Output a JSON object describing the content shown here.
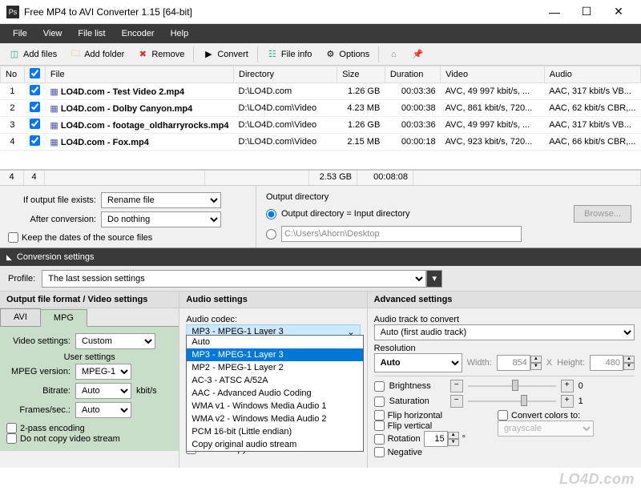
{
  "window": {
    "title": "Free MP4 to AVI Converter 1.15   [64-bit]",
    "logo": "Ps"
  },
  "menu": [
    "File",
    "View",
    "File list",
    "Encoder",
    "Help"
  ],
  "toolbar": {
    "add_files": "Add files",
    "add_folder": "Add folder",
    "remove": "Remove",
    "convert": "Convert",
    "file_info": "File info",
    "options": "Options"
  },
  "headers": {
    "no": "No",
    "file": "File",
    "directory": "Directory",
    "size": "Size",
    "duration": "Duration",
    "video": "Video",
    "audio": "Audio"
  },
  "files": [
    {
      "no": "1",
      "name": "LO4D.com - Test Video 2.mp4",
      "dir": "D:\\LO4D.com",
      "size": "1.26 GB",
      "dur": "00:03:36",
      "vid": "AVC, 49 997 kbit/s, ...",
      "aud": "AAC, 317 kbit/s VB..."
    },
    {
      "no": "2",
      "name": "LO4D.com - Dolby Canyon.mp4",
      "dir": "D:\\LO4D.com\\Video",
      "size": "4.23 MB",
      "dur": "00:00:38",
      "vid": "AVC, 861 kbit/s, 720...",
      "aud": "AAC, 62 kbit/s CBR,..."
    },
    {
      "no": "3",
      "name": "LO4D.com - footage_oldharryrocks.mp4",
      "dir": "D:\\LO4D.com\\Video",
      "size": "1.26 GB",
      "dur": "00:03:36",
      "vid": "AVC, 49 997 kbit/s, ...",
      "aud": "AAC, 317 kbit/s VB..."
    },
    {
      "no": "4",
      "name": "LO4D.com - Fox.mp4",
      "dir": "D:\\LO4D.com\\Video",
      "size": "2.15 MB",
      "dur": "00:00:18",
      "vid": "AVC, 923 kbit/s, 720...",
      "aud": "AAC, 66 kbit/s CBR,..."
    }
  ],
  "totals": {
    "count": "4",
    "checked": "4",
    "size": "2.53 GB",
    "dur": "00:08:08"
  },
  "midopts": {
    "if_exists_label": "If output file exists:",
    "if_exists_value": "Rename file",
    "after_label": "After conversion:",
    "after_value": "Do nothing",
    "keep_dates": "Keep the dates of the source files",
    "outdir_label": "Output directory",
    "radio1": "Output directory = Input directory",
    "radio2_path": "C:\\Users\\Ahorn\\Desktop",
    "browse": "Browse..."
  },
  "convset_hdr": "Conversion settings",
  "profile_label": "Profile:",
  "profile_value": "The last session settings",
  "vidpanel": {
    "hdr": "Output file format / Video settings",
    "tab_avi": "AVI",
    "tab_mpg": "MPG",
    "vs_label": "Video settings:",
    "vs_val": "Custom",
    "user_hdr": "User settings",
    "mpeg_label": "MPEG version:",
    "mpeg_val": "MPEG-1",
    "bitrate_label": "Bitrate:",
    "bitrate_val": "Auto",
    "bitrate_unit": "kbit/s",
    "fps_label": "Frames/sec.:",
    "fps_val": "Auto",
    "twopass": "2-pass encoding",
    "nocopyvid": "Do not copy video stream"
  },
  "audpanel": {
    "hdr": "Audio settings",
    "codec_label": "Audio codec:",
    "codec_sel": "MP3 - MPEG-1 Layer 3",
    "options": [
      "Auto",
      "MP3 - MPEG-1 Layer 3",
      "MP2 - MPEG-1 Layer 2",
      "AC-3 - ATSC A/52A",
      "AAC - Advanced Audio Coding",
      "WMA v1 - Windows Media Audio 1",
      "WMA v2 - Windows Media Audio 2",
      "PCM 16-bit (Little endian)",
      "Copy original audio stream"
    ],
    "nocopyaud": "Do not copy audio stream"
  },
  "advpanel": {
    "hdr": "Advanced settings",
    "track_label": "Audio track to convert",
    "track_val": "Auto (first audio track)",
    "res_label": "Resolution",
    "res_val": "Auto",
    "width_label": "Width:",
    "width_val": "854",
    "height_label": "Height:",
    "height_val": "480",
    "x": "X",
    "brightness": "Brightness",
    "saturation": "Saturation",
    "fliph": "Flip horizontal",
    "flipv": "Flip vertical",
    "negative": "Negative",
    "rotation": "Rotation",
    "rotation_val": "15",
    "convcolors": "Convert colors to:",
    "grayscale": "grayscale",
    "bval": "0",
    "sval": "1"
  },
  "watermark": "LO4D.com"
}
